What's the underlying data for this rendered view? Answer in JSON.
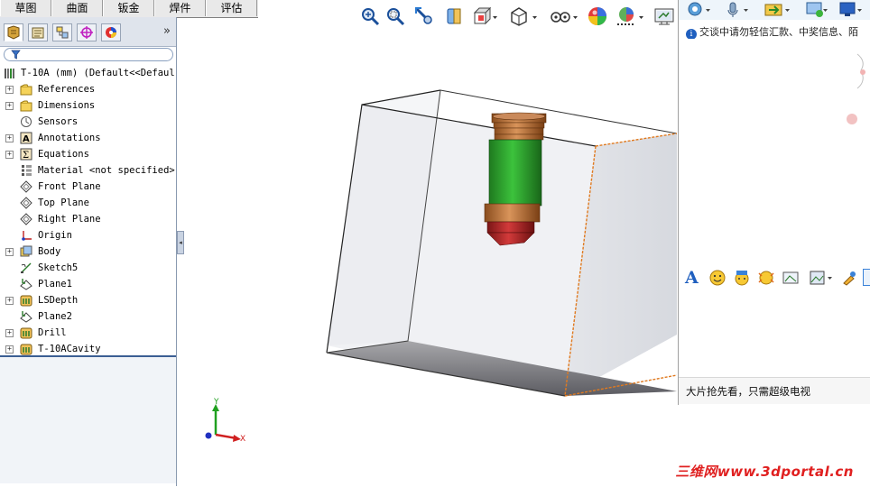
{
  "command_tabs": [
    "草图",
    "曲面",
    "钣金",
    "焊件",
    "评估"
  ],
  "feature_tree": {
    "root_label": "T-10A  (mm)  (Default<<Defaul",
    "items": [
      {
        "label": "References",
        "icon": "folder-icon",
        "expandable": true
      },
      {
        "label": "Dimensions",
        "icon": "folder-icon",
        "expandable": true
      },
      {
        "label": "Sensors",
        "icon": "sensor-icon",
        "expandable": false
      },
      {
        "label": "Annotations",
        "icon": "annotation-icon",
        "expandable": true
      },
      {
        "label": "Equations",
        "icon": "equation-icon",
        "expandable": true
      },
      {
        "label": "Material <not specified>",
        "icon": "material-icon",
        "expandable": false
      },
      {
        "label": "Front Plane",
        "icon": "plane-icon",
        "expandable": false
      },
      {
        "label": "Top Plane",
        "icon": "plane-icon",
        "expandable": false
      },
      {
        "label": "Right Plane",
        "icon": "plane-icon",
        "expandable": false
      },
      {
        "label": "Origin",
        "icon": "origin-icon",
        "expandable": false
      },
      {
        "label": "Body",
        "icon": "body-icon",
        "expandable": true
      },
      {
        "label": "Sketch5",
        "icon": "sketch-icon",
        "expandable": false
      },
      {
        "label": "Plane1",
        "icon": "plane-feature-icon",
        "expandable": false
      },
      {
        "label": "LSDepth",
        "icon": "feature-icon",
        "expandable": true
      },
      {
        "label": "Plane2",
        "icon": "plane-feature-icon",
        "expandable": false
      },
      {
        "label": "Drill",
        "icon": "feature-icon",
        "expandable": true
      },
      {
        "label": "T-10ACavity",
        "icon": "feature-icon",
        "expandable": true
      }
    ]
  },
  "fm_tabs": [
    "feature-manager-icon",
    "property-manager-icon",
    "configuration-manager-icon",
    "dimxpert-icon",
    "display-manager-icon"
  ],
  "fm_expand_label": "»",
  "view_toolbar": [
    "zoom-to-fit-icon",
    "zoom-to-area-icon",
    "previous-view-icon",
    "section-view-icon",
    "view-orientation-icon",
    "display-style-icon",
    "hide-show-icon",
    "edit-appearance-icon",
    "apply-scene-icon",
    "view-settings-icon"
  ],
  "triad": {
    "x_label": "X",
    "y_label": "Y"
  },
  "chat": {
    "notice": "交谈中请勿轻信汇款、中奖信息、陌",
    "ad_text": "大片抢先看，只需超级电视",
    "tools": [
      "font-icon",
      "emoji-icon",
      "magic-emoji-icon",
      "shake-icon",
      "screenshot-icon",
      "image-icon",
      "more-icon"
    ]
  },
  "watermark": "三维网www.3dportal.cn",
  "colors": {
    "accent": "#3b5e93",
    "edge_highlight": "#e07a20",
    "watermark": "#e02020"
  }
}
